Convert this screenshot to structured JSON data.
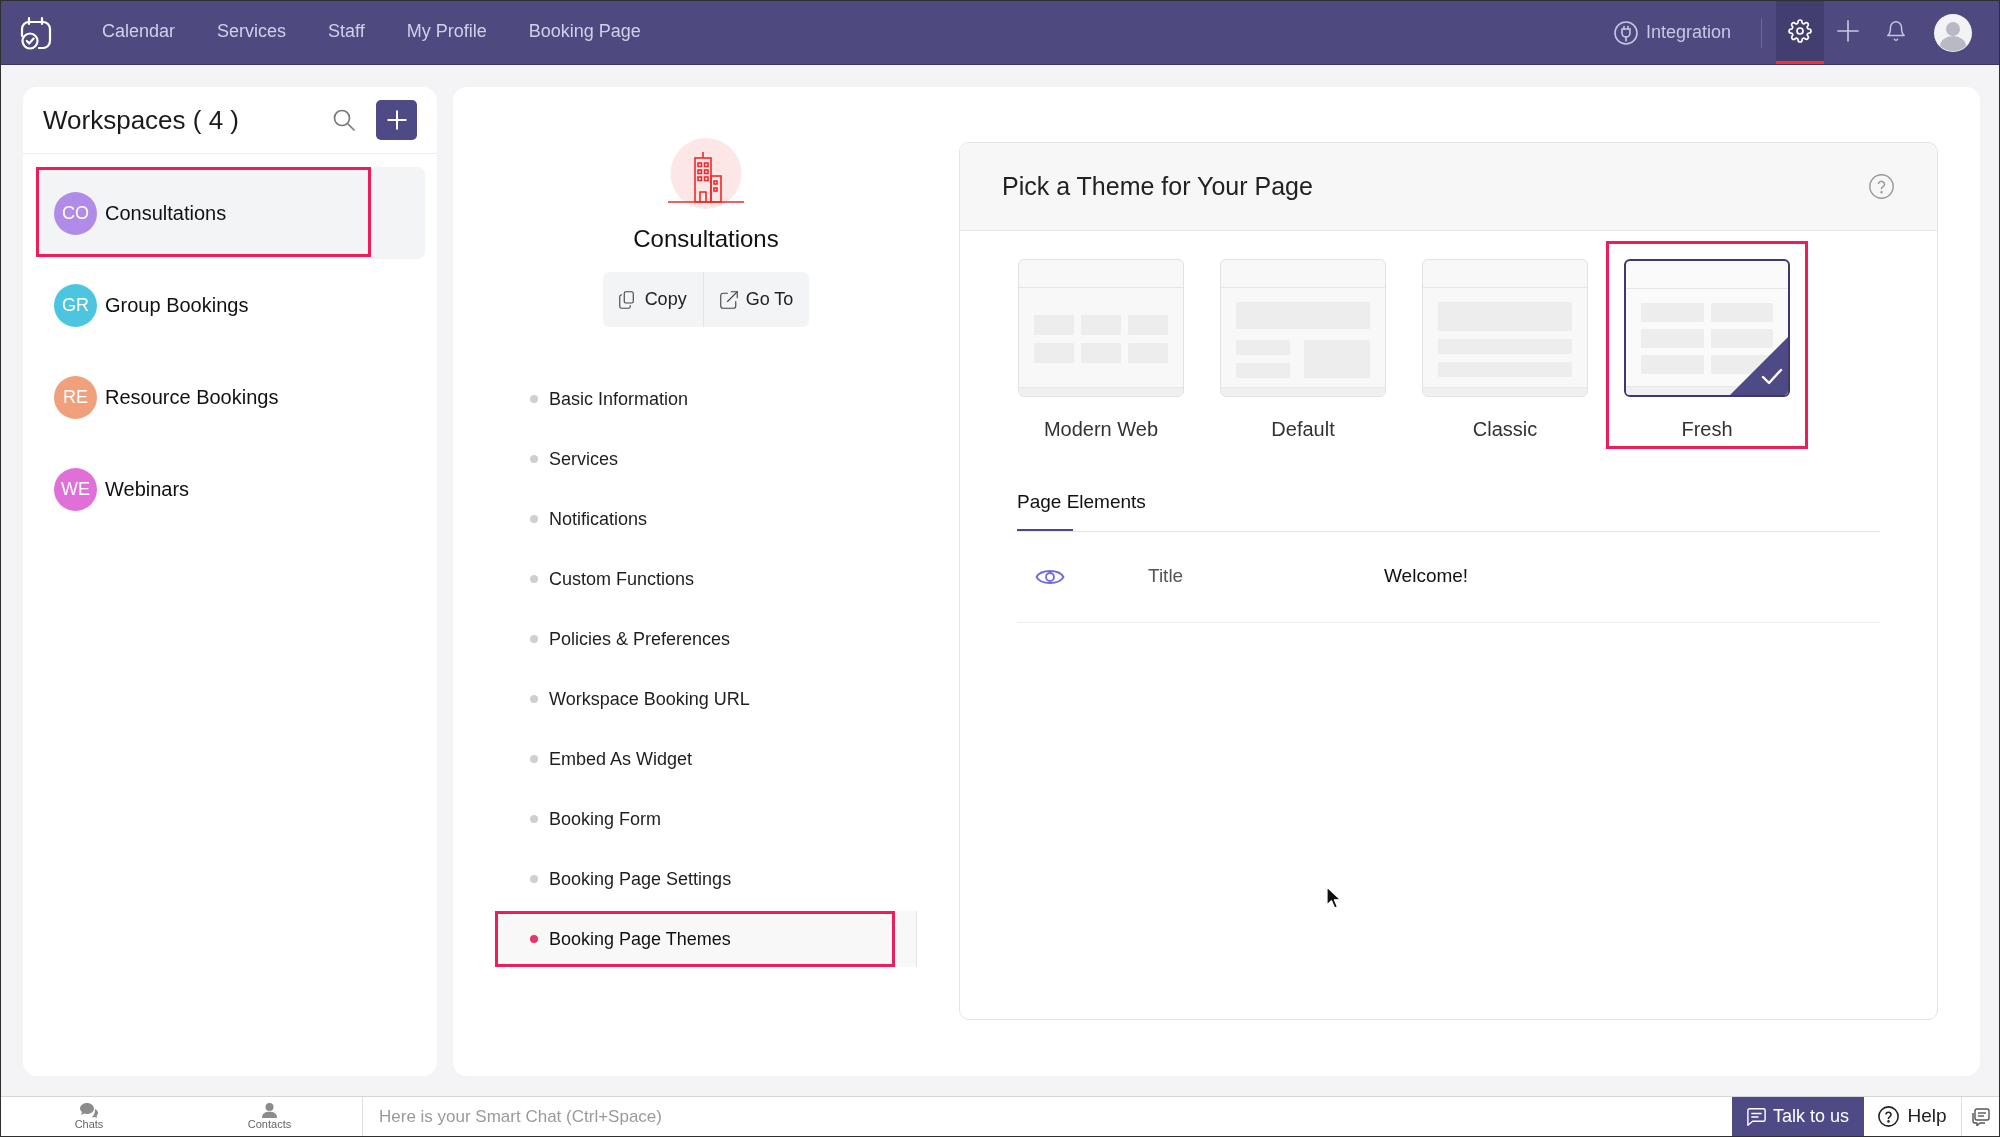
{
  "top_bar": {
    "tabs": [
      {
        "label": "Calendar",
        "selected": false
      },
      {
        "label": "Services",
        "selected": false
      },
      {
        "label": "Staff",
        "selected": false
      },
      {
        "label": "My Profile",
        "selected": false
      },
      {
        "label": "Booking Page",
        "selected": false
      }
    ],
    "integration": {
      "label": "Integration"
    },
    "tools": [
      {
        "kind": "settings",
        "selected": true
      },
      {
        "kind": "add",
        "selected": false
      },
      {
        "kind": "notifications",
        "selected": false
      }
    ]
  },
  "workspaces": {
    "title": "Workspaces ( 4 )",
    "items": [
      {
        "initials": "CO",
        "label": "Consultations",
        "color": "#b08ce8",
        "selected": true,
        "highlighted": true
      },
      {
        "initials": "GR",
        "label": "Group Bookings",
        "color": "#4cc6e0",
        "selected": false,
        "highlighted": false
      },
      {
        "initials": "RE",
        "label": "Resource Bookings",
        "color": "#f0a07a",
        "selected": false,
        "highlighted": false
      },
      {
        "initials": "WE",
        "label": "Webinars",
        "color": "#e070d8",
        "selected": false,
        "highlighted": false
      }
    ]
  },
  "workspace_detail": {
    "title": "Consultations",
    "actions": [
      {
        "kind": "copy",
        "label": "Copy"
      },
      {
        "kind": "open",
        "label": "Go To"
      }
    ],
    "menu": [
      {
        "label": "Basic Information",
        "selected": false,
        "highlighted": false
      },
      {
        "label": "Services",
        "selected": false,
        "highlighted": false
      },
      {
        "label": "Notifications",
        "selected": false,
        "highlighted": false
      },
      {
        "label": "Custom Functions",
        "selected": false,
        "highlighted": false
      },
      {
        "label": "Policies & Preferences",
        "selected": false,
        "highlighted": false
      },
      {
        "label": "Workspace Booking URL",
        "selected": false,
        "highlighted": false
      },
      {
        "label": "Embed As Widget",
        "selected": false,
        "highlighted": false
      },
      {
        "label": "Booking Form",
        "selected": false,
        "highlighted": false
      },
      {
        "label": "Booking Page Settings",
        "selected": false,
        "highlighted": false
      },
      {
        "label": "Booking Page Themes",
        "selected": true,
        "highlighted": true
      }
    ]
  },
  "theme_panel": {
    "title": "Pick a Theme for Your Page",
    "themes": [
      {
        "label": "Modern Web",
        "kind": "columns",
        "selected": false,
        "highlighted": false
      },
      {
        "label": "Default",
        "kind": "split",
        "selected": false,
        "highlighted": false
      },
      {
        "label": "Classic",
        "kind": "rows",
        "selected": false,
        "highlighted": false
      },
      {
        "label": "Fresh",
        "kind": "grid",
        "selected": true,
        "highlighted": true
      }
    ],
    "tabs": [
      {
        "label": "Page Elements",
        "selected": true
      }
    ],
    "elements": [
      {
        "visible": true,
        "label": "Title",
        "value": "Welcome!"
      }
    ]
  },
  "bottom_bar": {
    "chats": "Chats",
    "contacts": "Contacts",
    "smart_chat": {
      "placeholder": "Here is your Smart Chat (Ctrl+Space)"
    },
    "talk_button": "Talk to us",
    "help": "Help"
  }
}
